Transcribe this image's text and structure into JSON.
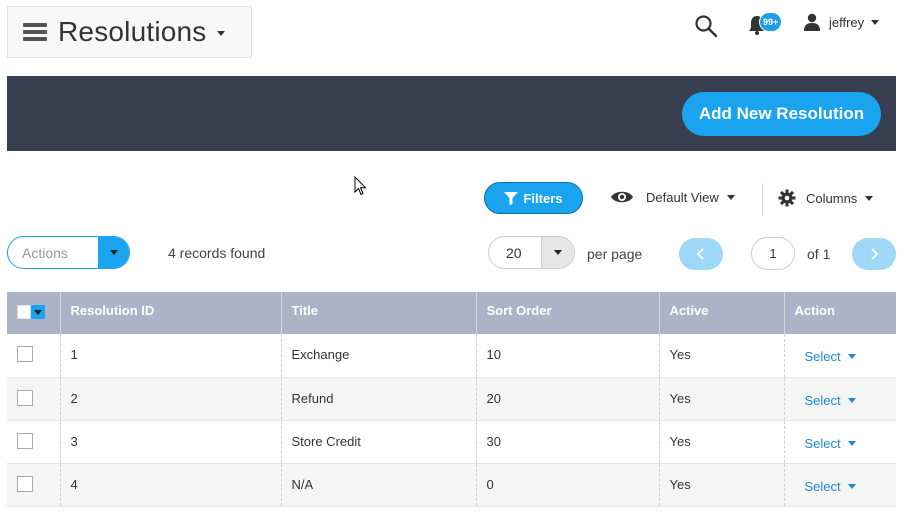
{
  "header": {
    "title": "Resolutions",
    "notification_badge": "99+",
    "username": "jeffrey"
  },
  "banner": {
    "add_button_label": "Add New Resolution"
  },
  "toolbar": {
    "filters_label": "Filters",
    "view_label": "Default View",
    "columns_label": "Columns",
    "actions_placeholder": "Actions",
    "records_text": "4 records found",
    "per_page_value": "20",
    "per_page_label": "per page",
    "current_page": "1",
    "of_label": "of 1"
  },
  "table": {
    "columns": [
      "Resolution ID",
      "Title",
      "Sort Order",
      "Active",
      "Action"
    ],
    "rows": [
      {
        "id": "1",
        "title": "Exchange",
        "sort_order": "10",
        "active": "Yes",
        "action": "Select"
      },
      {
        "id": "2",
        "title": "Refund",
        "sort_order": "20",
        "active": "Yes",
        "action": "Select"
      },
      {
        "id": "3",
        "title": "Store Credit",
        "sort_order": "30",
        "active": "Yes",
        "action": "Select"
      },
      {
        "id": "4",
        "title": "N/A",
        "sort_order": "0",
        "active": "Yes",
        "action": "Select"
      }
    ]
  },
  "colors": {
    "accent": "#1aa3ee",
    "banner": "#373f51",
    "table_header": "#acb3c6",
    "link": "#1e88d4"
  },
  "icons": [
    "menu-icon",
    "search-icon",
    "bell-icon",
    "user-icon",
    "filter-icon",
    "eye-icon",
    "gear-icon",
    "chevron-left-icon",
    "chevron-right-icon",
    "cursor-pointer"
  ]
}
